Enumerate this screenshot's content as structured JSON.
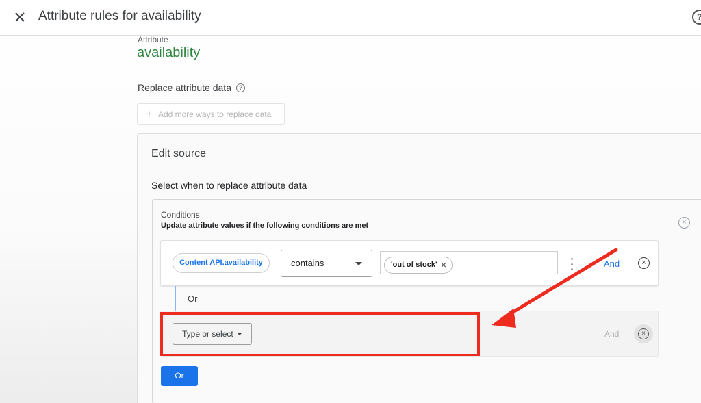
{
  "header": {
    "title": "Attribute rules for availability",
    "help_glyph": "?"
  },
  "attribute": {
    "label": "Attribute",
    "value": "availability",
    "value_color": "#2e8540"
  },
  "replace": {
    "title": "Replace attribute data",
    "help_glyph": "?",
    "add_more_label": "Add more ways to replace data"
  },
  "edit_source": {
    "title": "Edit source",
    "select_when": "Select when to replace attribute data"
  },
  "conditions": {
    "label": "Conditions",
    "description": "Update attribute values if the following conditions are met",
    "remove_glyph": "×",
    "rows": [
      {
        "field": "Content API.availability",
        "operator": "contains",
        "values": [
          "'out of stock'"
        ],
        "and_label": "And",
        "remove_glyph": "×"
      },
      {
        "field_placeholder": "Type or select",
        "and_label": "And",
        "remove_glyph": "×"
      }
    ],
    "or_separator": "Or",
    "or_button_label": "Or",
    "chip_remove_glyph": "×"
  },
  "colors": {
    "accent": "#1a73e8",
    "highlight": "#ee2b1f",
    "attribute_green": "#2e8540"
  },
  "icons": {
    "close": "close-icon",
    "help": "help-circle-icon",
    "add": "plus-icon",
    "dropdown": "caret-down-icon",
    "more": "more-vert-icon",
    "remove": "cancel-circle-icon"
  }
}
